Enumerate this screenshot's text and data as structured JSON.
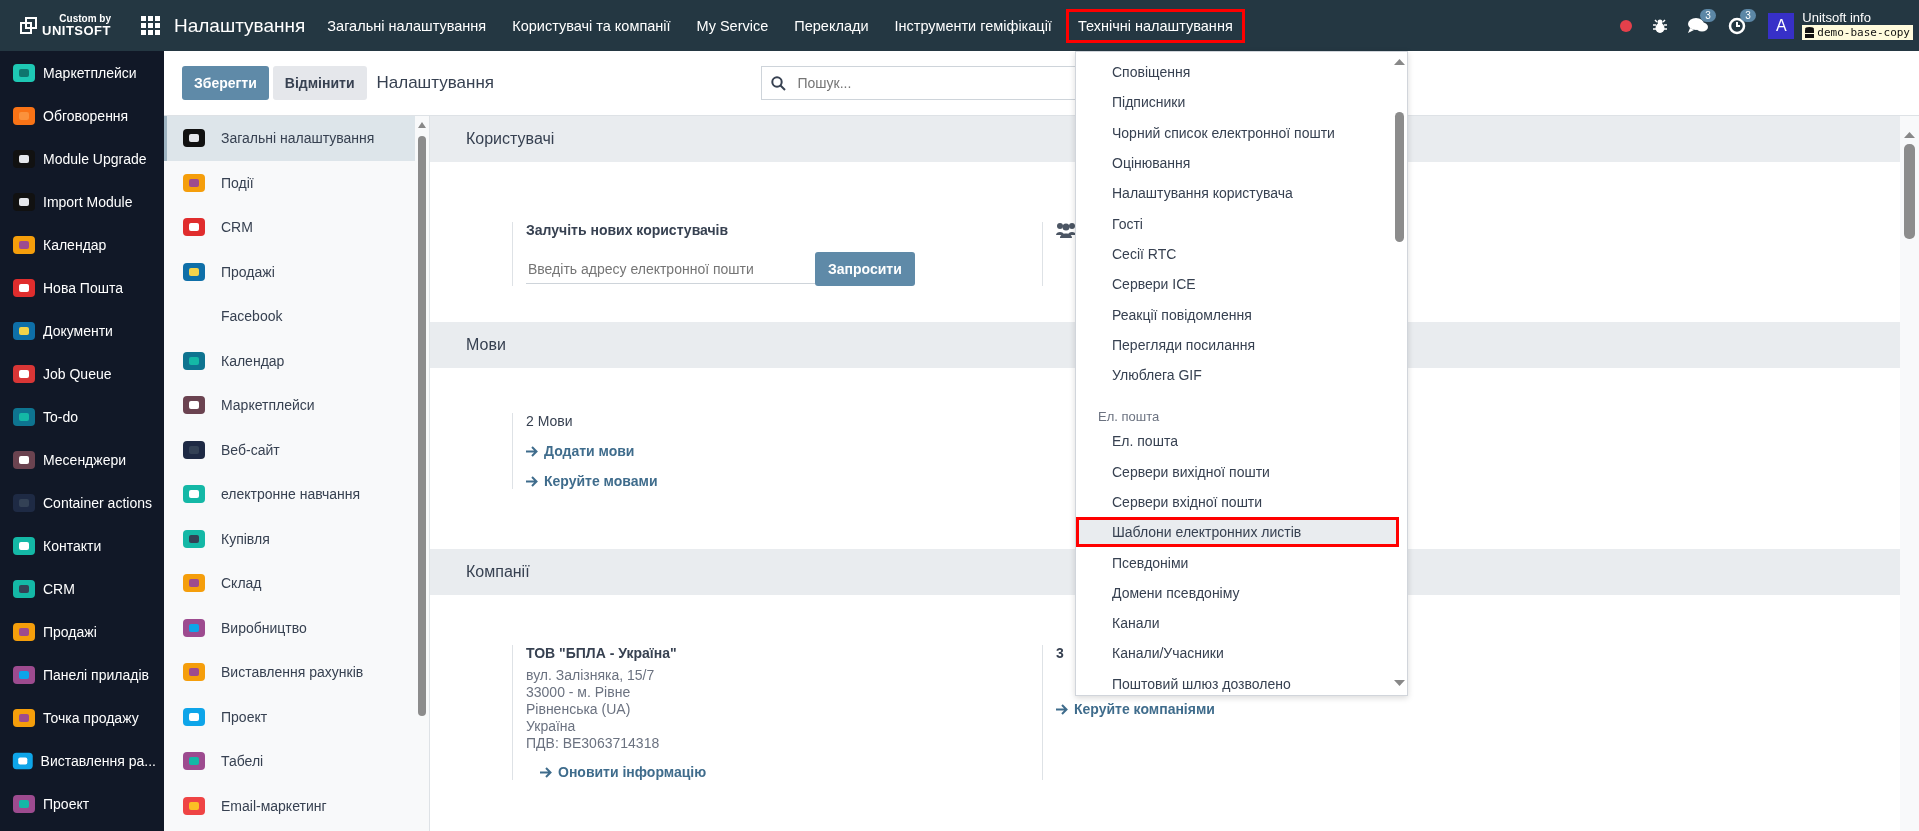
{
  "topbar": {
    "logo_top": "Custom by",
    "logo_bottom": "UNITSOFT",
    "app_title": "Налаштування",
    "menu": [
      {
        "label": "Загальні налаштування",
        "highlighted": false
      },
      {
        "label": "Користувачі та компанії",
        "highlighted": false
      },
      {
        "label": "My Service",
        "highlighted": false
      },
      {
        "label": "Переклади",
        "highlighted": false
      },
      {
        "label": "Інструменти геміфікації",
        "highlighted": false
      },
      {
        "label": "Технічні налаштування",
        "highlighted": true
      }
    ],
    "messages_badge": "3",
    "activities_badge": "3",
    "avatar": "A",
    "user": "Unitsoft info",
    "database": "demo-base-copy"
  },
  "apps_sidebar": {
    "items": [
      {
        "label": "Маркетплейси"
      },
      {
        "label": "Обговорення"
      },
      {
        "label": "Module Upgrade"
      },
      {
        "label": "Import Module"
      },
      {
        "label": "Календар"
      },
      {
        "label": "Нова Пошта"
      },
      {
        "label": "Документи"
      },
      {
        "label": "Job Queue"
      },
      {
        "label": "To-do"
      },
      {
        "label": "Месенджери"
      },
      {
        "label": "Container actions"
      },
      {
        "label": "Контакти"
      },
      {
        "label": "CRM"
      },
      {
        "label": "Продажі"
      },
      {
        "label": "Панелі приладів"
      },
      {
        "label": "Точка продажу"
      },
      {
        "label": "Виставлення ра..."
      },
      {
        "label": "Проект"
      }
    ]
  },
  "control_panel": {
    "save": "Зберегти",
    "discard": "Відмінити",
    "breadcrumb": "Налаштування",
    "search": {
      "placeholder": "Пошук..."
    }
  },
  "settings_nav": {
    "items": [
      {
        "label": "Загальні налаштування",
        "selected": true,
        "icon": true
      },
      {
        "label": "Події",
        "selected": false,
        "icon": true
      },
      {
        "label": "CRM",
        "selected": false,
        "icon": true
      },
      {
        "label": "Продажі",
        "selected": false,
        "icon": true
      },
      {
        "label": "Facebook",
        "selected": false,
        "icon": false
      },
      {
        "label": "Календар",
        "selected": false,
        "icon": true
      },
      {
        "label": "Маркетплейси",
        "selected": false,
        "icon": true
      },
      {
        "label": "Веб-сайт",
        "selected": false,
        "icon": true
      },
      {
        "label": "електронне навчання",
        "selected": false,
        "icon": true
      },
      {
        "label": "Купівля",
        "selected": false,
        "icon": true
      },
      {
        "label": "Склад",
        "selected": false,
        "icon": true
      },
      {
        "label": "Виробництво",
        "selected": false,
        "icon": true
      },
      {
        "label": "Виставлення рахунків",
        "selected": false,
        "icon": true
      },
      {
        "label": "Проект",
        "selected": false,
        "icon": true
      },
      {
        "label": "Табелі",
        "selected": false,
        "icon": true
      },
      {
        "label": "Email-маркетинг",
        "selected": false,
        "icon": true
      }
    ]
  },
  "users_section": {
    "title": "Користувачі",
    "invite_label": "Залучіть нових користувачів",
    "email": {
      "placeholder": "Введіть адресу електронної пошти"
    },
    "invite_button": "Запросити"
  },
  "languages_section": {
    "title": "Мови",
    "count": "2 Мови",
    "links": [
      "Додати мови",
      "Керуйте мовами"
    ]
  },
  "companies_section": {
    "title": "Компанії",
    "company_name": "ТОВ \"БПЛА - Україна\"",
    "address": [
      "вул. Залізняка, 15/7",
      "33000 - м. Рівне",
      "Рівненська (UA)",
      "Україна",
      "ПДВ:  BE3063714318"
    ],
    "update_link": "Оновити інформацію",
    "companies_count": "3",
    "manage_link": "Керуйте компаніями"
  },
  "dropdown": {
    "items": [
      {
        "label": "Сповіщення",
        "kind": "item",
        "highlighted": false
      },
      {
        "label": "Підписники",
        "kind": "item",
        "highlighted": false
      },
      {
        "label": "Чорний список електронної пошти",
        "kind": "item",
        "highlighted": false
      },
      {
        "label": "Оцінювання",
        "kind": "item",
        "highlighted": false
      },
      {
        "label": "Налаштування користувача",
        "kind": "item",
        "highlighted": false
      },
      {
        "label": "Гості",
        "kind": "item",
        "highlighted": false
      },
      {
        "label": "Сесії RTC",
        "kind": "item",
        "highlighted": false
      },
      {
        "label": "Сервери ICE",
        "kind": "item",
        "highlighted": false
      },
      {
        "label": "Реакції повідомлення",
        "kind": "item",
        "highlighted": false
      },
      {
        "label": "Перегляди посилання",
        "kind": "item",
        "highlighted": false
      },
      {
        "label": "Улюблега GIF",
        "kind": "item",
        "highlighted": false
      },
      {
        "label": "Ел. пошта",
        "kind": "header"
      },
      {
        "label": "Ел. пошта",
        "kind": "item",
        "highlighted": false
      },
      {
        "label": "Сервери вихідної пошти",
        "kind": "item",
        "highlighted": false
      },
      {
        "label": "Сервери вхідної пошти",
        "kind": "item",
        "highlighted": false
      },
      {
        "label": "Шаблони електронних листів",
        "kind": "item",
        "highlighted": true
      },
      {
        "label": "Псевдоніми",
        "kind": "item",
        "highlighted": false
      },
      {
        "label": "Домени псевдоніму",
        "kind": "item",
        "highlighted": false
      },
      {
        "label": "Канали",
        "kind": "item",
        "highlighted": false
      },
      {
        "label": "Канали/Учасники",
        "kind": "item",
        "highlighted": false
      },
      {
        "label": "Поштовий шлюз дозволено",
        "kind": "item",
        "highlighted": false
      }
    ]
  }
}
